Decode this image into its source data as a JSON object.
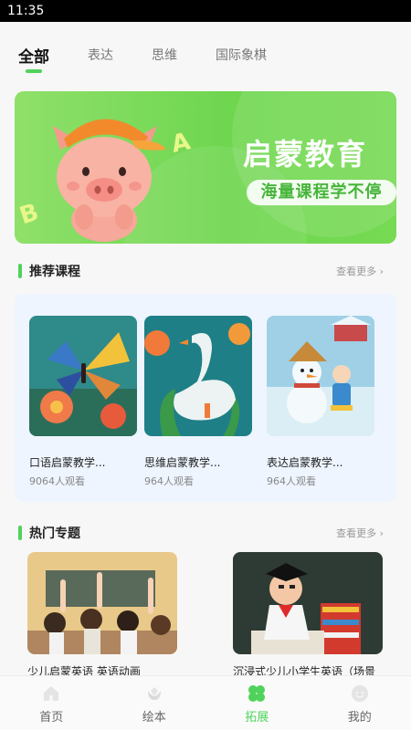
{
  "status": {
    "time": "11:35"
  },
  "tabs": [
    {
      "label": "全部",
      "active": true
    },
    {
      "label": "表达",
      "active": false
    },
    {
      "label": "思维",
      "active": false
    },
    {
      "label": "国际象棋",
      "active": false
    }
  ],
  "banner": {
    "title": "启蒙教育",
    "subtitle": "海量课程学不停",
    "letter_a": "A",
    "letter_b": "B"
  },
  "recommended": {
    "title": "推荐课程",
    "more": "查看更多",
    "courses": [
      {
        "title": "口语启蒙教学...",
        "views": "9064人观看"
      },
      {
        "title": "思维启蒙教学...",
        "views": "964人观看"
      },
      {
        "title": "表达启蒙教学...",
        "views": "964人观看"
      }
    ]
  },
  "hot": {
    "title": "热门专题",
    "more": "查看更多",
    "topics": [
      {
        "title": "少儿启蒙英语 英语动画"
      },
      {
        "title": "沉浸式少儿小学生英语（场景"
      }
    ]
  },
  "nav": [
    {
      "label": "首页",
      "icon": "home-icon",
      "active": false
    },
    {
      "label": "绘本",
      "icon": "flower-icon",
      "active": false
    },
    {
      "label": "拓展",
      "icon": "clover-icon",
      "active": true
    },
    {
      "label": "我的",
      "icon": "face-icon",
      "active": false
    }
  ],
  "colors": {
    "accent": "#4fd35b",
    "banner": "#76da53"
  }
}
